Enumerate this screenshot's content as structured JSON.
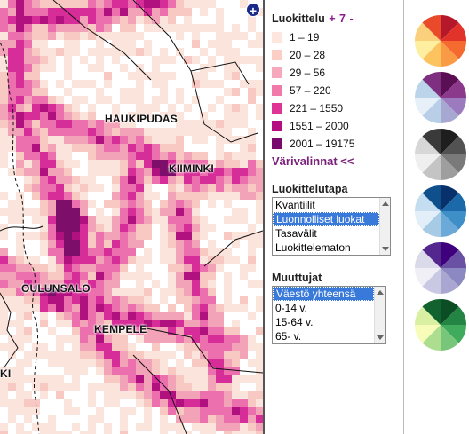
{
  "map": {
    "place_labels": [
      "HAUKIPUDAS",
      "KIIMINKI",
      "OULUNSALO",
      "KEMPELE",
      "KI"
    ],
    "zoom_button": "+",
    "density_palette": [
      "#fbe4dc",
      "#f8c9c3",
      "#f3a3b8",
      "#ec6fae",
      "#d62d99",
      "#b1107f",
      "#7d0f6b"
    ]
  },
  "legend": {
    "title": "Luokittelu",
    "plus": "+",
    "count": "7",
    "minus": "-",
    "items": [
      {
        "label": "1 – 19",
        "color": "#fde6dd"
      },
      {
        "label": "20 – 28",
        "color": "#fbcfc6"
      },
      {
        "label": "29 – 56",
        "color": "#f6a9bc"
      },
      {
        "label": "57 – 220",
        "color": "#f07aa9"
      },
      {
        "label": "221 – 1550",
        "color": "#dd3496"
      },
      {
        "label": "1551 – 2000",
        "color": "#b40d82"
      },
      {
        "label": "2001 – 19175",
        "color": "#7a0b6e"
      }
    ]
  },
  "color_toggle": "Värivalinnat <<",
  "classification_method": {
    "title": "Luokittelutapa",
    "options": [
      "Kvantiilit",
      "Luonnolliset luokat",
      "Tasavälit",
      "Luokittelematon"
    ],
    "selected": 1
  },
  "variables": {
    "title": "Muuttujat",
    "options": [
      "Väestö yhteensä",
      "0-14 v.",
      "15-64 v.",
      "65- v."
    ],
    "selected": 0
  },
  "palettes": [
    {
      "name": "red-orange-yellow",
      "colors": [
        "#b5172b",
        "#e2332a",
        "#f56a2f",
        "#f99b45",
        "#fcc35e",
        "#feeea0",
        "#fbd07c",
        "#e84a2a"
      ]
    },
    {
      "name": "purple-blue",
      "colors": [
        "#5a0f55",
        "#8b3a8b",
        "#9b7bbd",
        "#a7a8d2",
        "#b9cfe7",
        "#e7eff8",
        "#bcd4ea",
        "#7f2f7f"
      ]
    },
    {
      "name": "greys",
      "colors": [
        "#1e1e1e",
        "#525252",
        "#7a7a7a",
        "#9e9e9e",
        "#c4c4c4",
        "#efefef",
        "#d7d7d7",
        "#3a3a3a"
      ]
    },
    {
      "name": "blues",
      "colors": [
        "#08306b",
        "#1b69a8",
        "#3e8fc7",
        "#6ba9d8",
        "#a7cae5",
        "#e2eef8",
        "#c4ddf0",
        "#0f4f8c"
      ]
    },
    {
      "name": "purples",
      "colors": [
        "#3f007d",
        "#6a51a3",
        "#8c88c2",
        "#a9a6d1",
        "#c9c9e3",
        "#f0eff6",
        "#dadaeb",
        "#54278f"
      ]
    },
    {
      "name": "greens",
      "colors": [
        "#0b4d24",
        "#238443",
        "#41ab5d",
        "#78c679",
        "#addd8e",
        "#f7fcb9",
        "#d9f0a3",
        "#12622f"
      ]
    }
  ]
}
